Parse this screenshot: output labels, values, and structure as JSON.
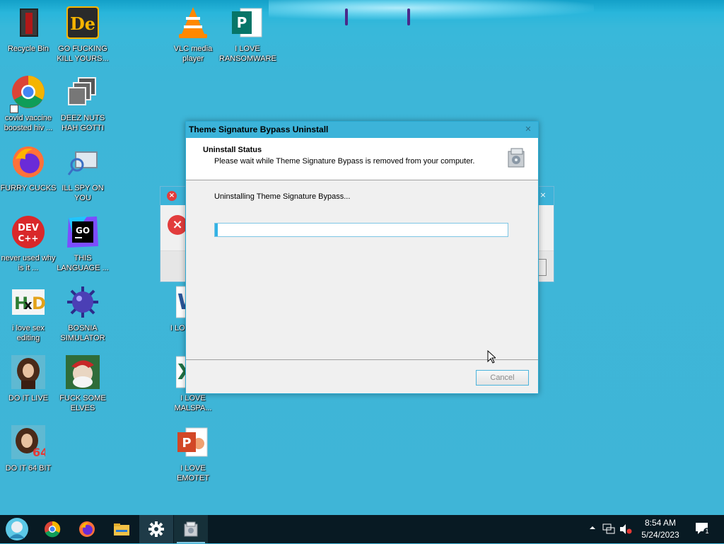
{
  "desktop": {
    "icons": [
      {
        "label": "Recycle Bin",
        "icon": "recycle-bin-icon"
      },
      {
        "label": "GO FUCKING KILL YOURS...",
        "icon": "dx-app-icon"
      },
      {
        "label": "VLC media player",
        "icon": "vlc-icon"
      },
      {
        "label": "I LOVE RANSOMWARE",
        "icon": "publisher-icon"
      },
      {
        "label": "covid vaccine boosted hiv ...",
        "icon": "chrome-icon"
      },
      {
        "label": "DEEZ NUTS HAH GOTTI",
        "icon": "stacked-windows-icon"
      },
      {
        "label": "FURRY CUCKS",
        "icon": "firefox-icon"
      },
      {
        "label": "ILL SPY ON YOU",
        "icon": "magnifier-monitor-icon"
      },
      {
        "label": "never used why is it ...",
        "icon": "devcpp-icon"
      },
      {
        "label": "THIS LANGUAGE ...",
        "icon": "goland-icon"
      },
      {
        "label": "i love sex editing",
        "icon": "hxd-icon"
      },
      {
        "label": "BOSNIA SIMULATOR",
        "icon": "mine-icon"
      },
      {
        "label": "DO IT LIVE",
        "icon": "portrait-icon"
      },
      {
        "label": "FUCK SOME ELVES",
        "icon": "elf-icon"
      },
      {
        "label": "DO IT 64 BIT",
        "icon": "portrait-64-icon"
      },
      {
        "label": "I LOVE MA...",
        "icon": "word-icon"
      },
      {
        "label": "I LOVE MALSPA...",
        "icon": "excel-icon"
      },
      {
        "label": "I LOVE EMOTET",
        "icon": "powerpoint-icon"
      }
    ]
  },
  "dialog": {
    "title": "Theme Signature Bypass Uninstall",
    "header_title": "Uninstall Status",
    "header_subtitle": "Please wait while Theme Signature Bypass is removed from your computer.",
    "status_text": "Uninstalling Theme Signature Bypass...",
    "progress": 0.01,
    "cancel_label": "Cancel",
    "close_icon": "close-icon"
  },
  "taskbar": {
    "apps": [
      {
        "icon": "start-avatar-icon"
      },
      {
        "icon": "chrome-icon"
      },
      {
        "icon": "firefox-icon"
      },
      {
        "icon": "file-explorer-icon"
      },
      {
        "icon": "settings-gear-icon"
      },
      {
        "icon": "installer-icon"
      }
    ],
    "time": "8:54 AM",
    "date": "5/24/2023",
    "notification_count": "1"
  },
  "colors": {
    "accent": "#3cb3d9",
    "taskbar": "#081a23"
  }
}
